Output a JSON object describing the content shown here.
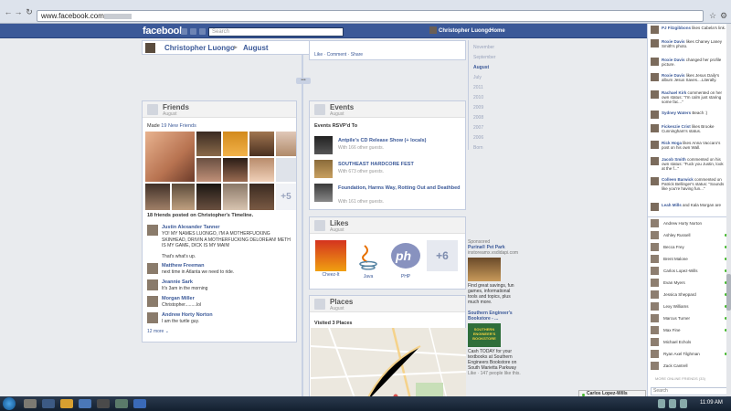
{
  "browser": {
    "url": "www.facebook.com"
  },
  "fb": {
    "logo": "facebook",
    "search_placeholder": "Search",
    "user_name": "Christopher Luongo",
    "home": "Home"
  },
  "timeline": {
    "name": "Christopher Luongo",
    "separator": "▸",
    "month": "August",
    "add": "+",
    "top_post_actions": "Like · Comment · Share",
    "years": [
      "November",
      "September",
      "August",
      "July",
      "2011",
      "2010",
      "2009",
      "2008",
      "2007",
      "2006",
      "Born"
    ]
  },
  "friends": {
    "title": "Friends",
    "subtitle": "August",
    "made_prefix": "Made",
    "made_link": "19 New Friends",
    "more_count": "+5",
    "posted": "18 friends posted on Christopher's Timeline.",
    "posts": [
      {
        "name": "Justin Alexander Tanner",
        "text": "YO! MY NAMES LUONGO, I'M A MOTHERFUCKING SKINHEAD, DRIVIN A MOTHERFUCKING DELOREAN! METH IS MY GAME, DICK IS MY MAIN!",
        "extra": "That's what's up."
      },
      {
        "name": "Matthew Freeman",
        "text": "next time in Atlanta we need to ride."
      },
      {
        "name": "Jeannie Sark",
        "text": "It's 3am in the morning"
      },
      {
        "name": "Morgan Miller",
        "text": "Christopher.........lol"
      },
      {
        "name": "Andrew Horty Norton",
        "text": "I am the turtle guy."
      }
    ],
    "more": "12 more ⌄"
  },
  "events": {
    "title": "Events",
    "subtitle": "August",
    "rsvp": "Events RSVP'd To",
    "items": [
      {
        "title": "Antpile's CD Release Show (+ locals)",
        "guests": "With 166 other guests."
      },
      {
        "title": "SOUTHEAST HARDCORE FEST",
        "guests": "With 673 other guests."
      },
      {
        "title": "Foundation, Harms Way, Rotting Out and Deathbed",
        "guests": "With 161 other guests."
      }
    ]
  },
  "likes": {
    "title": "Likes",
    "subtitle": "August",
    "items": [
      "Cheez-It",
      "Java",
      "PHP"
    ],
    "more": "+6"
  },
  "places": {
    "title": "Places",
    "subtitle": "August",
    "visited": "Visited 3 Places"
  },
  "sponsored": {
    "header": "Sponsored",
    "ads": [
      {
        "title": "Purina® Pet Park",
        "sub": "instoreamx.vsdidapi.com",
        "body": "Find great savings, fun games, informational tools and topics, plus much more."
      },
      {
        "title": "Southern Engineer's Bookstore - ...",
        "sub": "",
        "body": "Cash TODAY for your textbooks at Southern Engineers Bookstore on South Marietta Parkway",
        "likes": "Like · 147 people like this."
      }
    ],
    "ad_text": "SOUTHERN ENGINEER'S BOOKSTORE"
  },
  "ticker": [
    {
      "name": "PJ Fitzgibbons",
      "text": "likes Cabela's link."
    },
    {
      "name": "Roxie Davis",
      "text": "likes Chaney Laney Smith's photo."
    },
    {
      "name": "Roxie Davis",
      "text": "changed her profile picture."
    },
    {
      "name": "Roxie Davis",
      "text": "likes Jesus Daily's album Jesus Saves....Literally."
    },
    {
      "name": "Rachael Kirk",
      "text": "commented on her own status: \"I'm calm just staring some fac...\""
    },
    {
      "name": "Sydney Waters",
      "text": "Beach :)"
    },
    {
      "name": "Fickenzie Crist",
      "text": "likes Brooke Cunningham's status."
    },
    {
      "name": "Rick Hoga",
      "text": "likes Anna Vaccaro's post on his own Wall."
    },
    {
      "name": "Jacob Smith",
      "text": "commented on his own status: \"Fuck you Justin, look at the f...\""
    },
    {
      "name": "Colleen Barwick",
      "text": "commented on Patrick Bellinger's status: \"Sounds like you're having fun...\""
    },
    {
      "name": "Leah Mills",
      "text": "and Kala Morgan are"
    }
  ],
  "chat": {
    "friends": [
      "Andrew Horty Norton",
      "Ashley Russell",
      "Becca Frey",
      "Brent Malone",
      "Carlos Lopez-Wills",
      "Evan Myers",
      "Jessica Sheppard",
      "Lexy Williams",
      "Marcus Turner",
      "Max Fine",
      "Michael Echols",
      "Ryan Axel Tilghman",
      "Zack Cantrell"
    ],
    "more_online": "MORE ONLINE FRIENDS (33)",
    "search": "Search",
    "open_chat": "Carlos Lopez-Wills"
  },
  "taskbar": {
    "clock": "11:09 AM"
  }
}
